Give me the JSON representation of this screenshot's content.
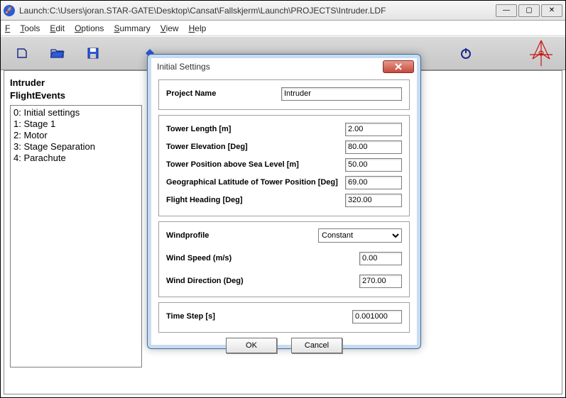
{
  "window": {
    "title": "Launch:C:\\Users\\joran.STAR-GATE\\Desktop\\Cansat\\Fallskjerm\\Launch\\PROJECTS\\Intruder.LDF",
    "min_glyph": "—",
    "max_glyph": "▢",
    "close_glyph": "✕"
  },
  "menu": {
    "file": "File",
    "tools": "Tools",
    "edit": "Edit",
    "options": "Options",
    "summary": "Summary",
    "view": "View",
    "help": "Help"
  },
  "side": {
    "project": "Intruder",
    "section": "FlightEvents",
    "items": [
      "0: Initial settings",
      "1: Stage 1",
      "2: Motor",
      "3: Stage Separation",
      "4: Parachute"
    ]
  },
  "dialog": {
    "title": "Initial Settings",
    "project_name_label": "Project Name",
    "project_name_value": "Intruder",
    "tower_length_label": "Tower Length [m]",
    "tower_length_value": "2.00",
    "tower_elev_label": "Tower Elevation [Deg]",
    "tower_elev_value": "80.00",
    "tower_pos_label": "Tower Position above Sea Level [m]",
    "tower_pos_value": "50.00",
    "lat_label": "Geographical Latitude of Tower Position [Deg]",
    "lat_value": "69.00",
    "heading_label": "Flight Heading [Deg]",
    "heading_value": "320.00",
    "windprofile_label": "Windprofile",
    "windprofile_value": "Constant",
    "windspeed_label": "Wind Speed (m/s)",
    "windspeed_value": "0.00",
    "winddir_label": "Wind Direction (Deg)",
    "winddir_value": "270.00",
    "timestep_label": "Time Step [s]",
    "timestep_value": "0.001000",
    "ok": "OK",
    "cancel": "Cancel"
  }
}
